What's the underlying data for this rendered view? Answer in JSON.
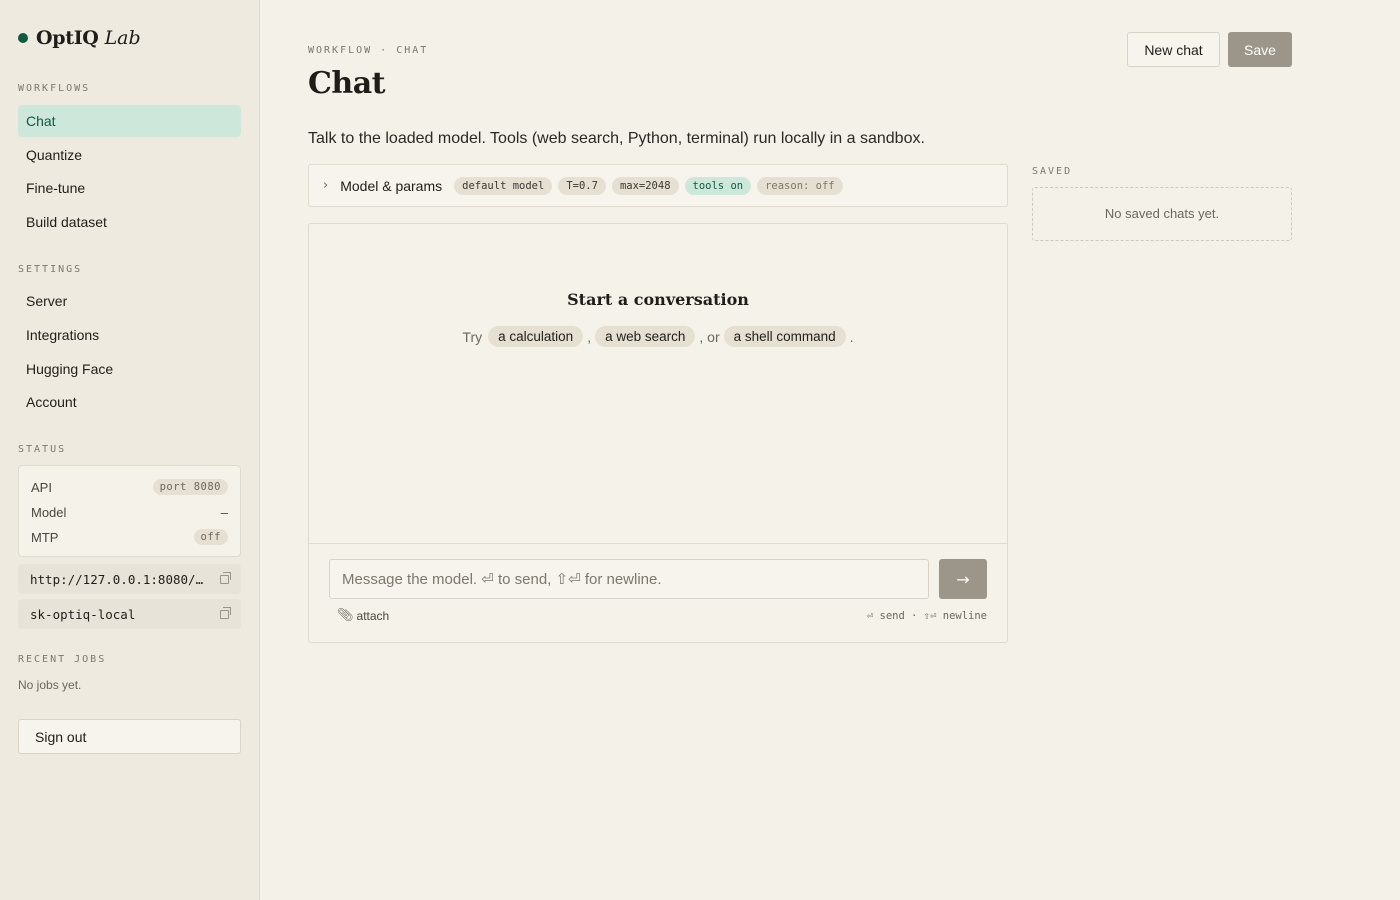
{
  "brand": {
    "name": "OptIQ",
    "sub": "Lab"
  },
  "sidebar": {
    "workflows_label": "WORKFLOWS",
    "workflows": [
      {
        "label": "Chat",
        "active": true
      },
      {
        "label": "Quantize"
      },
      {
        "label": "Fine-tune"
      },
      {
        "label": "Build dataset"
      }
    ],
    "settings_label": "SETTINGS",
    "settings": [
      {
        "label": "Server"
      },
      {
        "label": "Integrations"
      },
      {
        "label": "Hugging Face"
      },
      {
        "label": "Account"
      }
    ],
    "status_label": "STATUS",
    "status": {
      "api_label": "API",
      "api_value": "port 8080",
      "model_label": "Model",
      "model_value": "–",
      "mtp_label": "MTP",
      "mtp_value": "off"
    },
    "endpoint": "http://127.0.0.1:8080/…",
    "api_key": "sk-optiq-local",
    "recent_jobs_label": "RECENT JOBS",
    "recent_jobs_empty": "No jobs yet.",
    "sign_out": "Sign out"
  },
  "header": {
    "breadcrumb": "WORKFLOW · CHAT",
    "title": "Chat",
    "new_chat": "New chat",
    "save": "Save"
  },
  "description": "Talk to the loaded model. Tools (web search, Python, terminal) run locally in a sandbox.",
  "params": {
    "label": "Model & params",
    "tags": {
      "model": "default model",
      "temperature": "T=0.7",
      "max_tokens": "max=2048",
      "tools": "tools on",
      "reason": "reason: off"
    }
  },
  "chat": {
    "empty_title": "Start a conversation",
    "try": "Try",
    "suggestions": [
      "a calculation",
      "a web search",
      "a shell command"
    ],
    "sep_comma": ",",
    "sep_or": ", or",
    "end": ".",
    "placeholder": "Message the model. ⏎ to send, ⇧⏎ for newline.",
    "send_icon": "→",
    "attach": "attach",
    "hint": "⏎ send · ⇧⏎ newline"
  },
  "saved": {
    "label": "SAVED",
    "empty": "No saved chats yet."
  },
  "colors": {
    "accent": "#0e5a43",
    "accent_bg": "#cde8da",
    "background": "#f4f1e9",
    "sidebar_bg": "#eeeae0",
    "button_primary": "#9c968a"
  }
}
